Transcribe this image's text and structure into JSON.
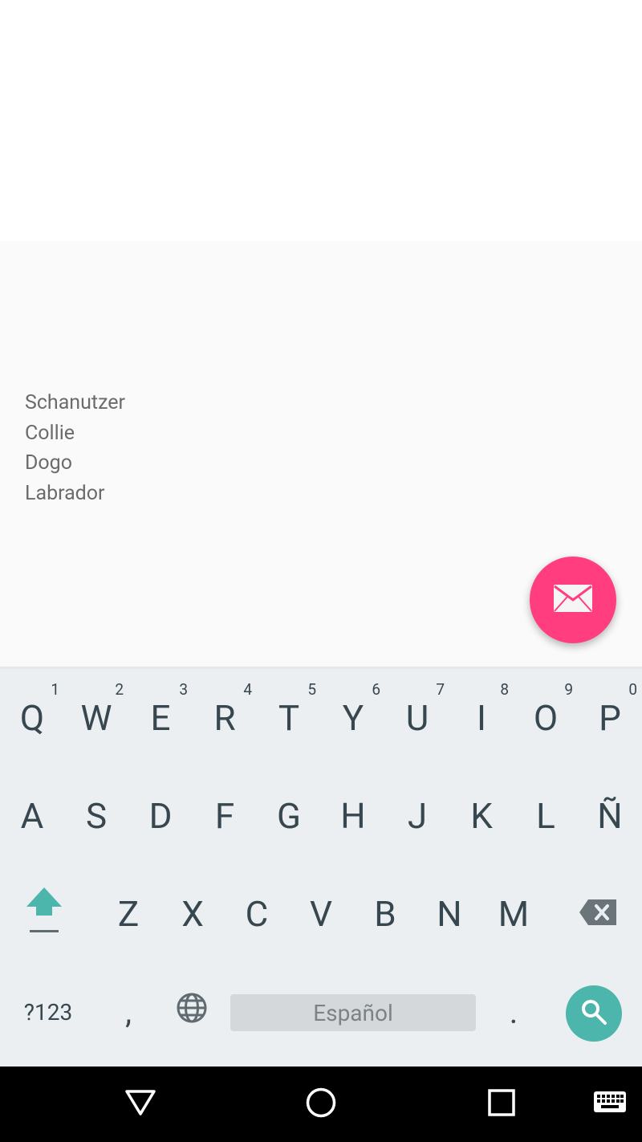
{
  "content": {
    "dogs": [
      "Schanutzer",
      "Collie",
      "Dogo",
      "Labrador"
    ]
  },
  "fab": {
    "icon": "mail-icon",
    "color": "#ff3d7f"
  },
  "keyboard": {
    "row1": [
      {
        "label": "Q",
        "hint": "1"
      },
      {
        "label": "W",
        "hint": "2"
      },
      {
        "label": "E",
        "hint": "3"
      },
      {
        "label": "R",
        "hint": "4"
      },
      {
        "label": "T",
        "hint": "5"
      },
      {
        "label": "Y",
        "hint": "6"
      },
      {
        "label": "U",
        "hint": "7"
      },
      {
        "label": "I",
        "hint": "8"
      },
      {
        "label": "O",
        "hint": "9"
      },
      {
        "label": "P",
        "hint": "0"
      }
    ],
    "row2": [
      "A",
      "S",
      "D",
      "F",
      "G",
      "H",
      "J",
      "K",
      "L",
      "Ñ"
    ],
    "row3": [
      "Z",
      "X",
      "C",
      "V",
      "B",
      "N",
      "M"
    ],
    "bottom": {
      "symbols_label": "?123",
      "comma": ",",
      "space_label": "Español",
      "period": "."
    },
    "icons": {
      "shift": "shift-icon",
      "delete": "backspace-icon",
      "language": "globe-icon",
      "action": "search-icon"
    },
    "accent": "#4db6ac"
  },
  "navbar": {
    "icons": [
      "back-icon",
      "home-icon",
      "recents-icon",
      "keyboard-switch-icon"
    ]
  }
}
